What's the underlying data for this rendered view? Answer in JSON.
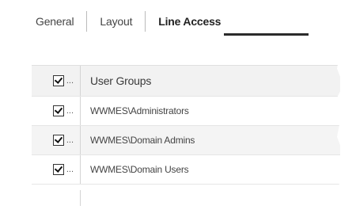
{
  "tabs": [
    {
      "label": "General",
      "active": false
    },
    {
      "label": "Layout",
      "active": false
    },
    {
      "label": "Line Access",
      "active": true
    }
  ],
  "grid": {
    "header": {
      "label": "User Groups",
      "checked": true
    },
    "rows": [
      {
        "label": "WWMES\\Administrators",
        "checked": true
      },
      {
        "label": "WWMES\\Domain Admins",
        "checked": true
      },
      {
        "label": "WWMES\\Domain Users",
        "checked": true
      }
    ],
    "ellipsis": "..."
  },
  "colors": {
    "active_tab_underline": "#2b2b2b",
    "row_alt_bg": "#f4f4f4",
    "header_bg": "#f2f2f2"
  }
}
